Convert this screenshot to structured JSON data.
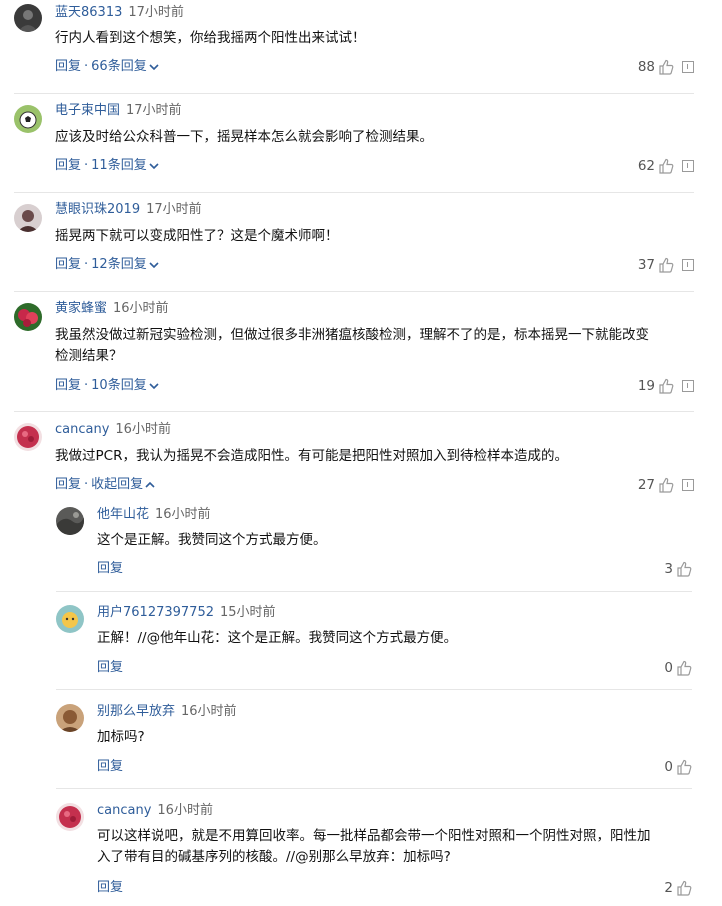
{
  "comments": [
    {
      "user": "蓝天86313",
      "time": "17小时前",
      "text": "行内人看到这个想笑，你给我摇两个阳性出来试试！",
      "reply_label": "回复",
      "replies_link": "66条回复",
      "likes": "88"
    },
    {
      "user": "电子束中国",
      "time": "17小时前",
      "text": "应该及时给公众科普一下，摇晃样本怎么就会影响了检测结果。",
      "reply_label": "回复",
      "replies_link": "11条回复",
      "likes": "62"
    },
    {
      "user": "慧眼识珠2019",
      "time": "17小时前",
      "text": "摇晃两下就可以变成阳性了？这是个魔术师啊！",
      "reply_label": "回复",
      "replies_link": "12条回复",
      "likes": "37"
    },
    {
      "user": "黄家蜂蜜",
      "time": "16小时前",
      "text_line1": "我虽然没做过新冠实验检测，但做过很多非洲猪瘟核酸检测，理解不了的是，标本摇晃一下就能改变",
      "text_line2": "检测结果？",
      "reply_label": "回复",
      "replies_link": "10条回复",
      "likes": "19"
    },
    {
      "user": "cancany",
      "time": "16小时前",
      "text": "我做过PCR，我认为摇晃不会造成阳性。有可能是把阳性对照加入到待检样本造成的。",
      "reply_label": "回复",
      "replies_link": "收起回复",
      "likes": "27"
    }
  ],
  "replies": [
    {
      "user": "他年山花",
      "time": "16小时前",
      "text": "这个是正解。我赞同这个方式最方便。",
      "reply_label": "回复",
      "likes": "3"
    },
    {
      "user": "用户76127397752",
      "time": "15小时前",
      "text": "正解！//@他年山花：这个是正解。我赞同这个方式最方便。",
      "reply_label": "回复",
      "likes": "0"
    },
    {
      "user": "别那么早放弃",
      "time": "16小时前",
      "text": "加标吗?",
      "reply_label": "回复",
      "likes": "0"
    },
    {
      "user": "cancany",
      "time": "16小时前",
      "text_line1": "可以这样说吧，就是不用算回收率。每一批样品都会带一个阳性对照和一个阴性对照，阳性加",
      "text_line2": "入了带有目的碱基序列的核酸。//@别那么早放弃：加标吗?",
      "reply_label": "回复",
      "likes": "2"
    }
  ],
  "colors": {
    "link": "#2f5d9a",
    "icon": "#9a9a9a",
    "divider": "#e6e6e6"
  },
  "icons": {
    "like": "thumbs-up-icon",
    "report": "report-icon",
    "expand": "chevron-down-icon",
    "collapse": "chevron-up-icon"
  }
}
